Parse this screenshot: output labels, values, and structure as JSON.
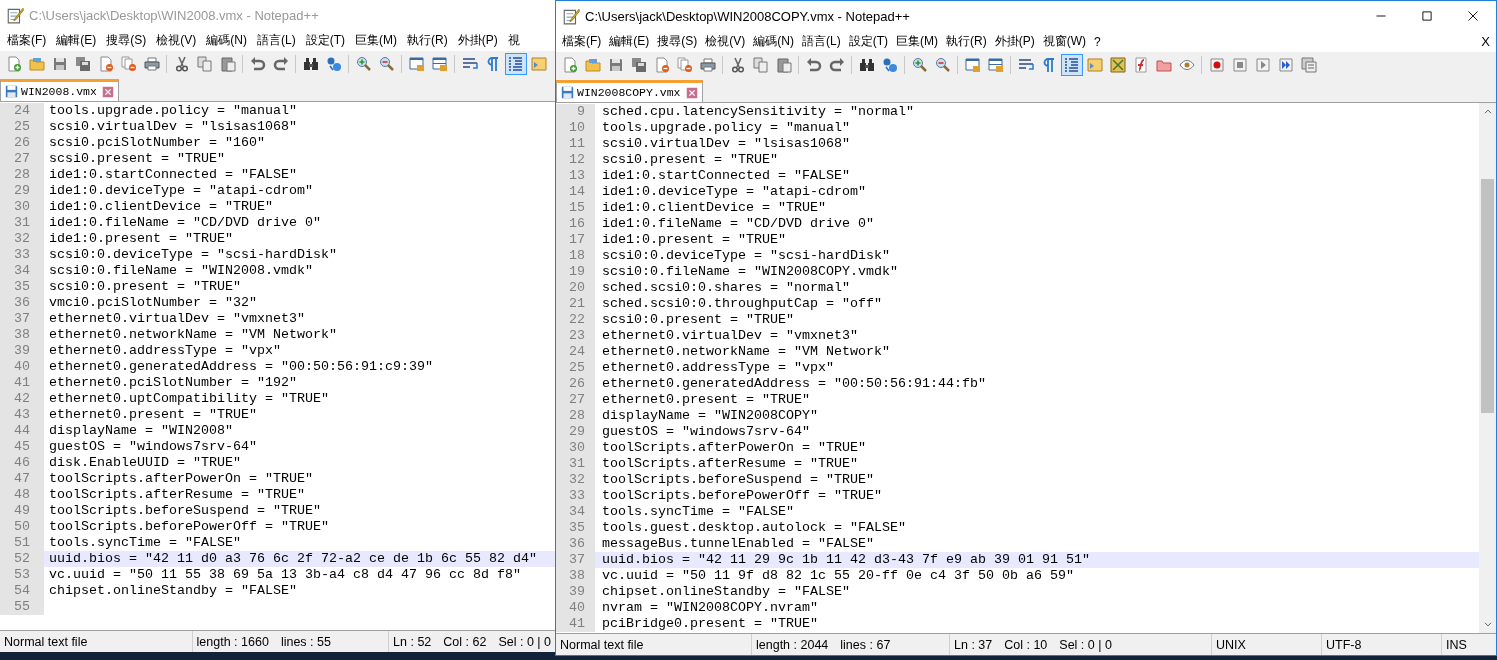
{
  "windows": [
    {
      "title": "C:\\Users\\jack\\Desktop\\WIN2008.vmx - Notepad++",
      "active": false,
      "menu": [
        "檔案(F)",
        "編輯(E)",
        "搜尋(S)",
        "檢視(V)",
        "編碼(N)",
        "語言(L)",
        "設定(T)",
        "巨集(M)",
        "執行(R)",
        "外掛(P)",
        "視"
      ],
      "toolbar": [
        {
          "kind": "button",
          "pressed": false
        },
        {
          "kind": "button",
          "pressed": false
        },
        {
          "kind": "button",
          "pressed": false
        },
        {
          "kind": "button",
          "pressed": false
        },
        {
          "kind": "button",
          "pressed": false
        },
        {
          "kind": "button",
          "pressed": false
        },
        {
          "kind": "button",
          "pressed": false
        },
        {
          "kind": "separator"
        },
        {
          "kind": "button",
          "pressed": false
        },
        {
          "kind": "button",
          "pressed": false
        },
        {
          "kind": "button",
          "pressed": false
        },
        {
          "kind": "separator"
        },
        {
          "kind": "button",
          "pressed": false
        },
        {
          "kind": "button",
          "pressed": false
        },
        {
          "kind": "separator"
        },
        {
          "kind": "button",
          "pressed": false
        },
        {
          "kind": "button",
          "pressed": false
        },
        {
          "kind": "separator"
        },
        {
          "kind": "button",
          "pressed": false
        },
        {
          "kind": "button",
          "pressed": false
        },
        {
          "kind": "separator"
        },
        {
          "kind": "button",
          "pressed": false
        },
        {
          "kind": "button",
          "pressed": false
        },
        {
          "kind": "separator"
        },
        {
          "kind": "button",
          "pressed": false
        },
        {
          "kind": "button",
          "pressed": false
        },
        {
          "kind": "button",
          "pressed": true
        },
        {
          "kind": "button",
          "pressed": false
        }
      ],
      "tabs": [
        {
          "label": "WIN2008.vmx",
          "selected": true
        }
      ],
      "editor": {
        "lines": [
          {
            "number": "24",
            "text": "tools.upgrade.policy = \"manual\"",
            "current": false
          },
          {
            "number": "25",
            "text": "scsi0.virtualDev = \"lsisas1068\"",
            "current": false
          },
          {
            "number": "26",
            "text": "scsi0.pciSlotNumber = \"160\"",
            "current": false
          },
          {
            "number": "27",
            "text": "scsi0.present = \"TRUE\"",
            "current": false
          },
          {
            "number": "28",
            "text": "ide1:0.startConnected = \"FALSE\"",
            "current": false
          },
          {
            "number": "29",
            "text": "ide1:0.deviceType = \"atapi-cdrom\"",
            "current": false
          },
          {
            "number": "30",
            "text": "ide1:0.clientDevice = \"TRUE\"",
            "current": false
          },
          {
            "number": "31",
            "text": "ide1:0.fileName = \"CD/DVD drive 0\"",
            "current": false
          },
          {
            "number": "32",
            "text": "ide1:0.present = \"TRUE\"",
            "current": false
          },
          {
            "number": "33",
            "text": "scsi0:0.deviceType = \"scsi-hardDisk\"",
            "current": false
          },
          {
            "number": "34",
            "text": "scsi0:0.fileName = \"WIN2008.vmdk\"",
            "current": false
          },
          {
            "number": "35",
            "text": "scsi0:0.present = \"TRUE\"",
            "current": false
          },
          {
            "number": "36",
            "text": "vmci0.pciSlotNumber = \"32\"",
            "current": false
          },
          {
            "number": "37",
            "text": "ethernet0.virtualDev = \"vmxnet3\"",
            "current": false
          },
          {
            "number": "38",
            "text": "ethernet0.networkName = \"VM Network\"",
            "current": false
          },
          {
            "number": "39",
            "text": "ethernet0.addressType = \"vpx\"",
            "current": false
          },
          {
            "number": "40",
            "text": "ethernet0.generatedAddress = \"00:50:56:91:c9:39\"",
            "current": false
          },
          {
            "number": "41",
            "text": "ethernet0.pciSlotNumber = \"192\"",
            "current": false
          },
          {
            "number": "42",
            "text": "ethernet0.uptCompatibility = \"TRUE\"",
            "current": false
          },
          {
            "number": "43",
            "text": "ethernet0.present = \"TRUE\"",
            "current": false
          },
          {
            "number": "44",
            "text": "displayName = \"WIN2008\"",
            "current": false
          },
          {
            "number": "45",
            "text": "guestOS = \"windows7srv-64\"",
            "current": false
          },
          {
            "number": "46",
            "text": "disk.EnableUUID = \"TRUE\"",
            "current": false
          },
          {
            "number": "47",
            "text": "toolScripts.afterPowerOn = \"TRUE\"",
            "current": false
          },
          {
            "number": "48",
            "text": "toolScripts.afterResume = \"TRUE\"",
            "current": false
          },
          {
            "number": "49",
            "text": "toolScripts.beforeSuspend = \"TRUE\"",
            "current": false
          },
          {
            "number": "50",
            "text": "toolScripts.beforePowerOff = \"TRUE\"",
            "current": false
          },
          {
            "number": "51",
            "text": "tools.syncTime = \"FALSE\"",
            "current": false
          },
          {
            "number": "52",
            "text": "uuid.bios = \"42 11 d0 a3 76 6c 2f 72-a2 ce de 1b 6c 55 82 d4\"",
            "current": true
          },
          {
            "number": "53",
            "text": "vc.uuid = \"50 11 55 38 69 5a 13 3b-a4 c8 d4 47 96 cc 8d f8\"",
            "current": false
          },
          {
            "number": "54",
            "text": "chipset.onlineStandby = \"FALSE\"",
            "current": false
          },
          {
            "number": "55",
            "current": false
          }
        ]
      },
      "status_bar": [
        [
          "Normal text file"
        ],
        [
          "length : 1660",
          "lines : 55"
        ],
        [
          "Ln : 52",
          "Col : 62",
          "Sel : 0 | 0"
        ]
      ]
    },
    {
      "title": "C:\\Users\\jack\\Desktop\\WIN2008COPY.vmx - Notepad++",
      "active": true,
      "window_controls": true,
      "scrollbar": true,
      "menu": [
        "檔案(F)",
        "編輯(E)",
        "搜尋(S)",
        "檢視(V)",
        "編碼(N)",
        "語言(L)",
        "設定(T)",
        "巨集(M)",
        "執行(R)",
        "外掛(P)",
        "視窗(W)",
        "?"
      ],
      "menu_close": "X",
      "toolbar": [
        {
          "kind": "button",
          "pressed": false
        },
        {
          "kind": "button",
          "pressed": false
        },
        {
          "kind": "button",
          "pressed": false
        },
        {
          "kind": "button",
          "pressed": false
        },
        {
          "kind": "button",
          "pressed": false
        },
        {
          "kind": "button",
          "pressed": false
        },
        {
          "kind": "button",
          "pressed": false
        },
        {
          "kind": "separator"
        },
        {
          "kind": "button",
          "pressed": false
        },
        {
          "kind": "button",
          "pressed": false
        },
        {
          "kind": "button",
          "pressed": false
        },
        {
          "kind": "separator"
        },
        {
          "kind": "button",
          "pressed": false
        },
        {
          "kind": "button",
          "pressed": false
        },
        {
          "kind": "separator"
        },
        {
          "kind": "button",
          "pressed": false
        },
        {
          "kind": "button",
          "pressed": false
        },
        {
          "kind": "separator"
        },
        {
          "kind": "button",
          "pressed": false
        },
        {
          "kind": "button",
          "pressed": false
        },
        {
          "kind": "separator"
        },
        {
          "kind": "button",
          "pressed": false
        },
        {
          "kind": "button",
          "pressed": false
        },
        {
          "kind": "separator"
        },
        {
          "kind": "button",
          "pressed": false
        },
        {
          "kind": "button",
          "pressed": false
        },
        {
          "kind": "button",
          "pressed": true
        },
        {
          "kind": "button",
          "pressed": false
        },
        {
          "kind": "button",
          "pressed": false
        },
        {
          "kind": "button",
          "pressed": false
        },
        {
          "kind": "button",
          "pressed": false
        },
        {
          "kind": "button",
          "pressed": false
        },
        {
          "kind": "separator"
        },
        {
          "kind": "button",
          "pressed": false
        },
        {
          "kind": "button",
          "pressed": false
        },
        {
          "kind": "button",
          "pressed": false
        },
        {
          "kind": "button",
          "pressed": false
        },
        {
          "kind": "button",
          "pressed": false
        }
      ],
      "tabs": [
        {
          "label": "WIN2008COPY.vmx",
          "selected": true
        }
      ],
      "editor": {
        "lines": [
          {
            "number": "9",
            "text": "sched.cpu.latencySensitivity = \"normal\"",
            "current": false
          },
          {
            "number": "10",
            "text": "tools.upgrade.policy = \"manual\"",
            "current": false
          },
          {
            "number": "11",
            "text": "scsi0.virtualDev = \"lsisas1068\"",
            "current": false
          },
          {
            "number": "12",
            "text": "scsi0.present = \"TRUE\"",
            "current": false
          },
          {
            "number": "13",
            "text": "ide1:0.startConnected = \"FALSE\"",
            "current": false
          },
          {
            "number": "14",
            "text": "ide1:0.deviceType = \"atapi-cdrom\"",
            "current": false
          },
          {
            "number": "15",
            "text": "ide1:0.clientDevice = \"TRUE\"",
            "current": false
          },
          {
            "number": "16",
            "text": "ide1:0.fileName = \"CD/DVD drive 0\"",
            "current": false
          },
          {
            "number": "17",
            "text": "ide1:0.present = \"TRUE\"",
            "current": false
          },
          {
            "number": "18",
            "text": "scsi0:0.deviceType = \"scsi-hardDisk\"",
            "current": false
          },
          {
            "number": "19",
            "text": "scsi0:0.fileName = \"WIN2008COPY.vmdk\"",
            "current": false
          },
          {
            "number": "20",
            "text": "sched.scsi0:0.shares = \"normal\"",
            "current": false
          },
          {
            "number": "21",
            "text": "sched.scsi0:0.throughputCap = \"off\"",
            "current": false
          },
          {
            "number": "22",
            "text": "scsi0:0.present = \"TRUE\"",
            "current": false
          },
          {
            "number": "23",
            "text": "ethernet0.virtualDev = \"vmxnet3\"",
            "current": false
          },
          {
            "number": "24",
            "text": "ethernet0.networkName = \"VM Network\"",
            "current": false
          },
          {
            "number": "25",
            "text": "ethernet0.addressType = \"vpx\"",
            "current": false
          },
          {
            "number": "26",
            "text": "ethernet0.generatedAddress = \"00:50:56:91:44:fb\"",
            "current": false
          },
          {
            "number": "27",
            "text": "ethernet0.present = \"TRUE\"",
            "current": false
          },
          {
            "number": "28",
            "text": "displayName = \"WIN2008COPY\"",
            "current": false
          },
          {
            "number": "29",
            "text": "guestOS = \"windows7srv-64\"",
            "current": false
          },
          {
            "number": "30",
            "text": "toolScripts.afterPowerOn = \"TRUE\"",
            "current": false
          },
          {
            "number": "31",
            "text": "toolScripts.afterResume = \"TRUE\"",
            "current": false
          },
          {
            "number": "32",
            "text": "toolScripts.beforeSuspend = \"TRUE\"",
            "current": false
          },
          {
            "number": "33",
            "text": "toolScripts.beforePowerOff = \"TRUE\"",
            "current": false
          },
          {
            "number": "34",
            "text": "tools.syncTime = \"FALSE\"",
            "current": false
          },
          {
            "number": "35",
            "text": "tools.guest.desktop.autolock = \"FALSE\"",
            "current": false
          },
          {
            "number": "36",
            "text": "messageBus.tunnelEnabled = \"FALSE\"",
            "current": false
          },
          {
            "number": "37",
            "text": "uuid.bios = \"42 11 29 9c 1b 11 42 d3-43 7f e9 ab 39 01 91 51\"",
            "current": true
          },
          {
            "number": "38",
            "text": "vc.uuid = \"50 11 9f d8 82 1c 55 20-ff 0e c4 3f 50 0b a6 59\"",
            "current": false
          },
          {
            "number": "39",
            "text": "chipset.onlineStandby = \"FALSE\"",
            "current": false
          },
          {
            "number": "40",
            "text": "nvram = \"WIN2008COPY.nvram\"",
            "current": false
          },
          {
            "number": "41",
            "text": "pciBridge0.present = \"TRUE\"",
            "current": false
          }
        ]
      },
      "status_bar": [
        [
          "Normal text file"
        ],
        [
          "length : 2044",
          "lines : 67"
        ],
        [
          "Ln : 37",
          "Col : 10",
          "Sel : 0 | 0"
        ],
        [
          "UNIX"
        ],
        [
          "UTF-8"
        ],
        [
          "INS"
        ]
      ]
    }
  ]
}
